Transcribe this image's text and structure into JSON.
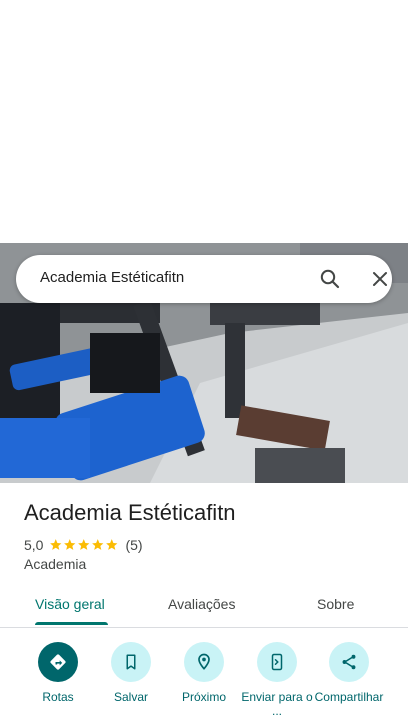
{
  "search": {
    "query": "Academia Estéticafitn"
  },
  "place": {
    "title": "Academia Estéticafitn",
    "rating": "5,0",
    "stars": 5,
    "review_count": "(5)",
    "category": "Academia"
  },
  "tabs": [
    {
      "label": "Visão geral",
      "active": true
    },
    {
      "label": "Avaliações",
      "active": false
    },
    {
      "label": "Sobre",
      "active": false
    }
  ],
  "actions": [
    {
      "label": "Rotas",
      "icon": "directions-icon"
    },
    {
      "label": "Salvar",
      "icon": "bookmark-icon"
    },
    {
      "label": "Próximo",
      "icon": "nearby-icon"
    },
    {
      "label": "Enviar para o ...",
      "icon": "send-to-phone-icon"
    },
    {
      "label": "Compartilhar",
      "icon": "share-icon"
    }
  ],
  "colors": {
    "accent": "#00766e",
    "action_bg": "#c9f3f6",
    "primary_action": "#00666b",
    "star": "#fbbc04"
  }
}
